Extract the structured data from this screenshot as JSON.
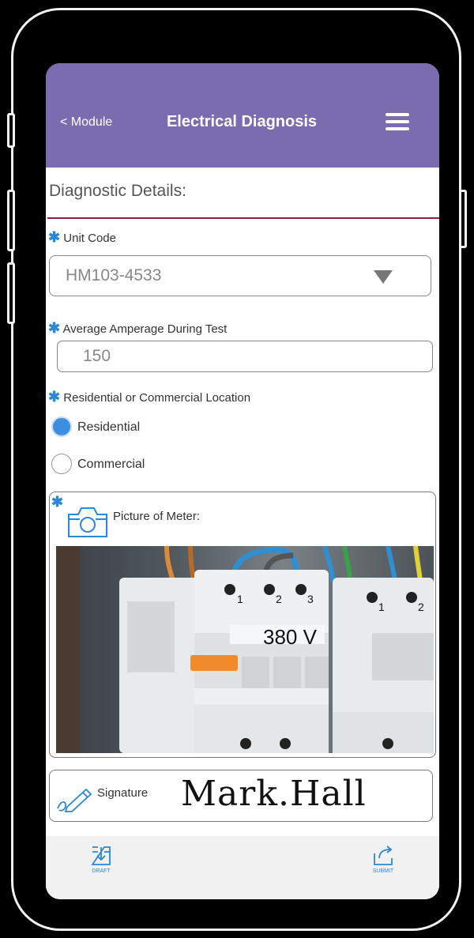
{
  "header": {
    "back_label": "< Module",
    "title": "Electrical Diagnosis",
    "menu_icon": "hamburger-menu-icon",
    "background_color": "#7a6cae"
  },
  "section": {
    "title": "Diagnostic Details:",
    "rule_color": "#8b1e3f"
  },
  "fields": {
    "unit_code": {
      "required_mark": "✱",
      "label": "Unit Code",
      "value": "HM103-4533"
    },
    "amperage": {
      "required_mark": "✱",
      "label": "Average Amperage During Test",
      "value": "150"
    },
    "location": {
      "required_mark": "✱",
      "label": "Residential or Commercial Location",
      "options": [
        {
          "label": "Residential",
          "selected": true
        },
        {
          "label": "Commercial",
          "selected": false
        }
      ]
    },
    "meter_picture": {
      "required_mark": "✱",
      "label": "Picture of Meter:",
      "icon": "camera-icon",
      "photo_text": "380 V",
      "photo_labels": [
        "1",
        "2",
        "3",
        "1",
        "2"
      ]
    },
    "signature": {
      "label": "Signature",
      "icon": "pen-icon",
      "value": "Mark.Hall"
    }
  },
  "footer": {
    "draft_label": "DRAFT",
    "draft_icon": "save-draft-icon",
    "submit_label": "SUBMIT",
    "submit_icon": "share-submit-icon"
  },
  "colors": {
    "accent": "#2a88d6",
    "radio_selected": "#3b8ee0"
  }
}
